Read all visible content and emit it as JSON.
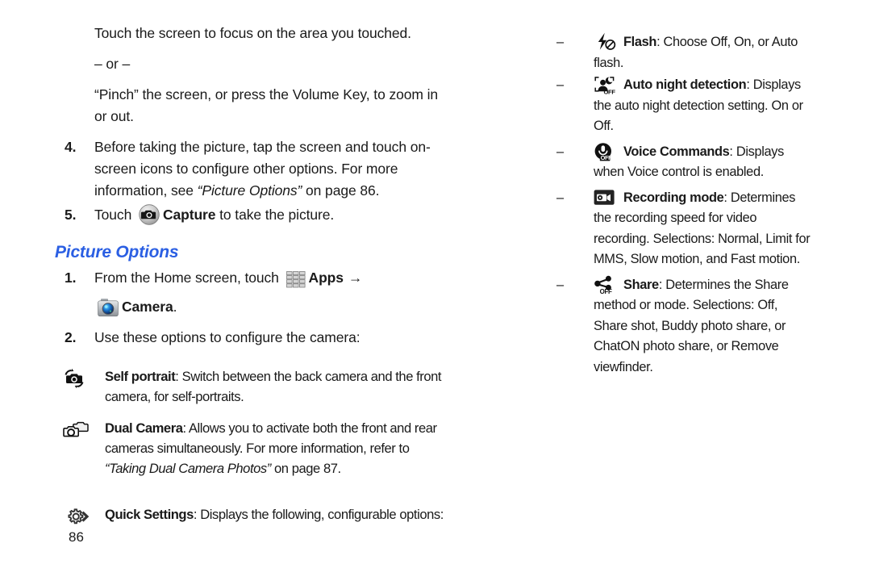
{
  "page": {
    "number": "86",
    "heading": "Picture Options",
    "heading_color": "#2b5fe3"
  },
  "left_column": {
    "intro": {
      "focus_text": "Touch the screen to focus on the area you touched.",
      "or_text": "– or –",
      "pinch_text": "“Pinch” the screen, or press the Volume Key, to zoom in or out."
    },
    "steps": [
      {
        "number": "4.",
        "text_before": "Before taking the picture, tap the screen and touch on-screen icons to configure other options. For more information, see ",
        "italic_ref": "“Picture Options”",
        "text_after": " on page 86."
      },
      {
        "number": "5.",
        "text_before": "Touch ",
        "icon": "camera-capture-icon",
        "bold_label": "Capture",
        "text_after": " to take the picture."
      }
    ],
    "options_steps": [
      {
        "number": "1.",
        "text_before": "From the Home screen, touch ",
        "icon1": "apps-grid-icon",
        "bold1": "Apps",
        "arrow": "→",
        "icon2": "camera-app-icon",
        "bold2": "Camera",
        "text_after": "."
      },
      {
        "number": "2.",
        "text": "Use these options to configure the camera:"
      }
    ],
    "features": [
      {
        "icon": "self-portrait-icon",
        "label": "Self portrait",
        "description": ": Switch between the back camera and the front camera, for self-portraits."
      },
      {
        "icon": "dual-camera-icon",
        "label": "Dual Camera",
        "description_before": ": Allows you to activate both the front and rear cameras simultaneously. For more information, refer to ",
        "italic_ref": "“Taking Dual Camera Photos”",
        "description_after": " on page 87."
      },
      {
        "icon": "quick-settings-gear-icon",
        "label": "Quick Settings",
        "description": ": Displays the following, configurable options:"
      }
    ]
  },
  "right_column": {
    "dash": "–",
    "items": [
      {
        "icon": "flash-off-icon",
        "label": "Flash",
        "description": ": Choose Off, On, or Auto flash."
      },
      {
        "icon": "auto-night-detection-off-icon",
        "label": "Auto night detection",
        "description": ": Displays the auto night detection setting. On or Off."
      },
      {
        "icon": "voice-commands-off-icon",
        "label": "Voice Commands",
        "description": ": Displays when Voice control is enabled."
      },
      {
        "icon": "recording-mode-icon",
        "label": "Recording mode",
        "description": ": Determines the recording speed for video recording. Selections: Normal, Limit for MMS, Slow motion, and Fast motion."
      },
      {
        "icon": "share-off-icon",
        "label": "Share",
        "description": ": Determines the Share method or mode. Selections: Off, Share shot, Buddy photo share, or ChatON photo share, or Remove viewfinder."
      }
    ]
  }
}
